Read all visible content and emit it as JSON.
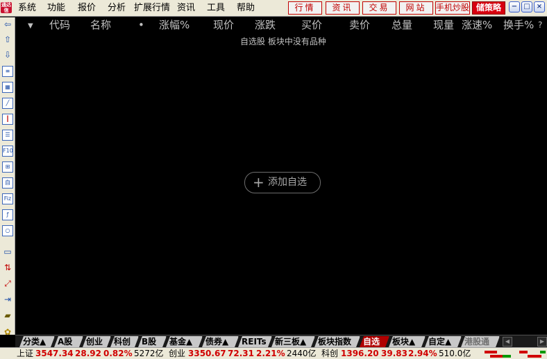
{
  "app": {
    "logo_text": "通达信"
  },
  "menu": [
    "系统",
    "功能",
    "报价",
    "分析",
    "扩展行情",
    "资讯",
    "工具",
    "帮助"
  ],
  "links": [
    "行情",
    "资讯",
    "交易",
    "网站",
    "手机炒股",
    "储策略"
  ],
  "window_controls": [
    "−",
    "□",
    "×"
  ],
  "columns": {
    "dropdown": "▼",
    "code": "代码",
    "name": "名称",
    "dot": "•",
    "change_pct": "涨幅%",
    "price": "现价",
    "change": "涨跌",
    "bid": "买价",
    "ask": "卖价",
    "volume": "总量",
    "cur_volume": "现量",
    "speed": "涨速%",
    "turnover": "换手%",
    "help": "?"
  },
  "empty_message": "自选股 板块中没有品种",
  "add_button": {
    "icon": "+",
    "label": "添加自选"
  },
  "tabs": [
    {
      "label": "分类▲",
      "state": "normal"
    },
    {
      "label": "A股",
      "state": "normal"
    },
    {
      "label": "创业",
      "state": "normal"
    },
    {
      "label": "科创",
      "state": "normal"
    },
    {
      "label": "B股",
      "state": "normal"
    },
    {
      "label": "基金▲",
      "state": "normal"
    },
    {
      "label": "债券▲",
      "state": "normal"
    },
    {
      "label": "REITs",
      "state": "normal"
    },
    {
      "label": "新三板▲",
      "state": "normal"
    },
    {
      "label": "板块指数",
      "state": "normal"
    },
    {
      "label": "自选",
      "state": "active"
    },
    {
      "label": "板块▲",
      "state": "normal"
    },
    {
      "label": "自定▲",
      "state": "normal"
    },
    {
      "label": "港股通",
      "state": "dim"
    }
  ],
  "status": {
    "sh": {
      "label": "上证",
      "price": "3547.34",
      "change": "28.92",
      "pct": "0.82%",
      "amount": "5272亿"
    },
    "cy": {
      "label": "创业",
      "price": "3350.67",
      "change": "72.31",
      "pct": "2.21%",
      "amount": "2440亿"
    },
    "kc": {
      "label": "科创",
      "price": "1396.20",
      "change": "39.83",
      "pct": "2.94%",
      "amount": "510.0亿"
    }
  },
  "colors": {
    "up": "#D00000",
    "active_tab": "#B00000",
    "accent": "#C00000"
  }
}
